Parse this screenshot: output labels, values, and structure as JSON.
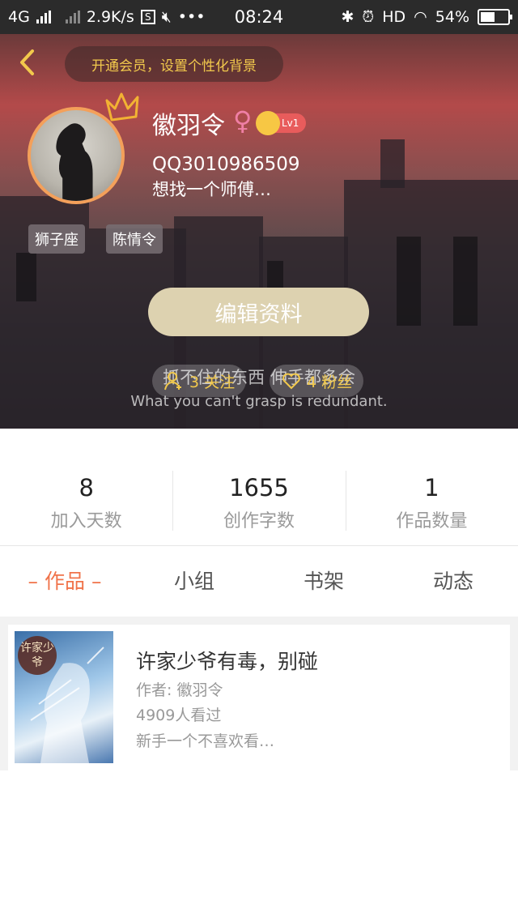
{
  "status_bar": {
    "network": "4G",
    "speed": "2.9K/s",
    "time": "08:24",
    "hd": "HD",
    "battery": "54%",
    "battery_level": 0.54
  },
  "header": {
    "vip_promo": "开通会员，设置个性化背景"
  },
  "profile": {
    "username": "徽羽令",
    "gender_symbol": "♀",
    "level": "Lv1",
    "qq": "QQ3010986509",
    "bio": "想找一个师傅…",
    "tags": [
      "狮子座",
      "陈情令"
    ],
    "edit_label": "编辑资料",
    "motto_cn": "抓不住的东西  伸手都多余",
    "motto_en": "What you can't grasp is redundant.",
    "following": "3 关注",
    "fans": "4 粉丝"
  },
  "stats": [
    {
      "num": "8",
      "label": "加入天数"
    },
    {
      "num": "1655",
      "label": "创作字数"
    },
    {
      "num": "1",
      "label": "作品数量"
    }
  ],
  "tabs": [
    "– 作品 –",
    "小组",
    "书架",
    "动态"
  ],
  "book": {
    "cover_text": "许家少爷",
    "title": "许家少爷有毒，别碰",
    "author": "作者: 徽羽令",
    "views": "4909人看过",
    "desc": "新手一个不喜欢看…"
  },
  "colors": {
    "accent": "#f0734a",
    "vip_text": "#f2c94c",
    "edit_button": "#ddd2b0"
  }
}
